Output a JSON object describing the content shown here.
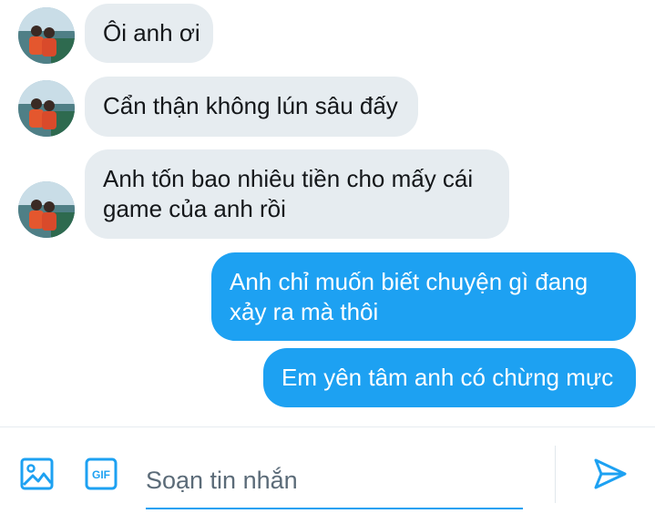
{
  "messages": [
    {
      "direction": "in",
      "text": "Ôi anh ơi"
    },
    {
      "direction": "in",
      "text": "Cẩn thận không lún sâu đấy"
    },
    {
      "direction": "in",
      "line1": "Anh tốn bao nhiêu tiền cho mấy cái",
      "line2": "game của anh rồi"
    },
    {
      "direction": "out",
      "line1": "Anh chỉ muốn biết chuyện gì đang",
      "line2": "xảy ra mà thôi"
    },
    {
      "direction": "out",
      "text": "Em yên tâm anh có chừng mực"
    }
  ],
  "composer": {
    "placeholder": "Soạn tin nhắn",
    "gif_label": "GIF",
    "icons": {
      "media": "image-icon",
      "gif": "gif-icon",
      "send": "send-icon"
    }
  },
  "colors": {
    "incoming_bubble": "#e6ecf0",
    "outgoing_bubble": "#1da1f2",
    "accent": "#1da1f2"
  }
}
